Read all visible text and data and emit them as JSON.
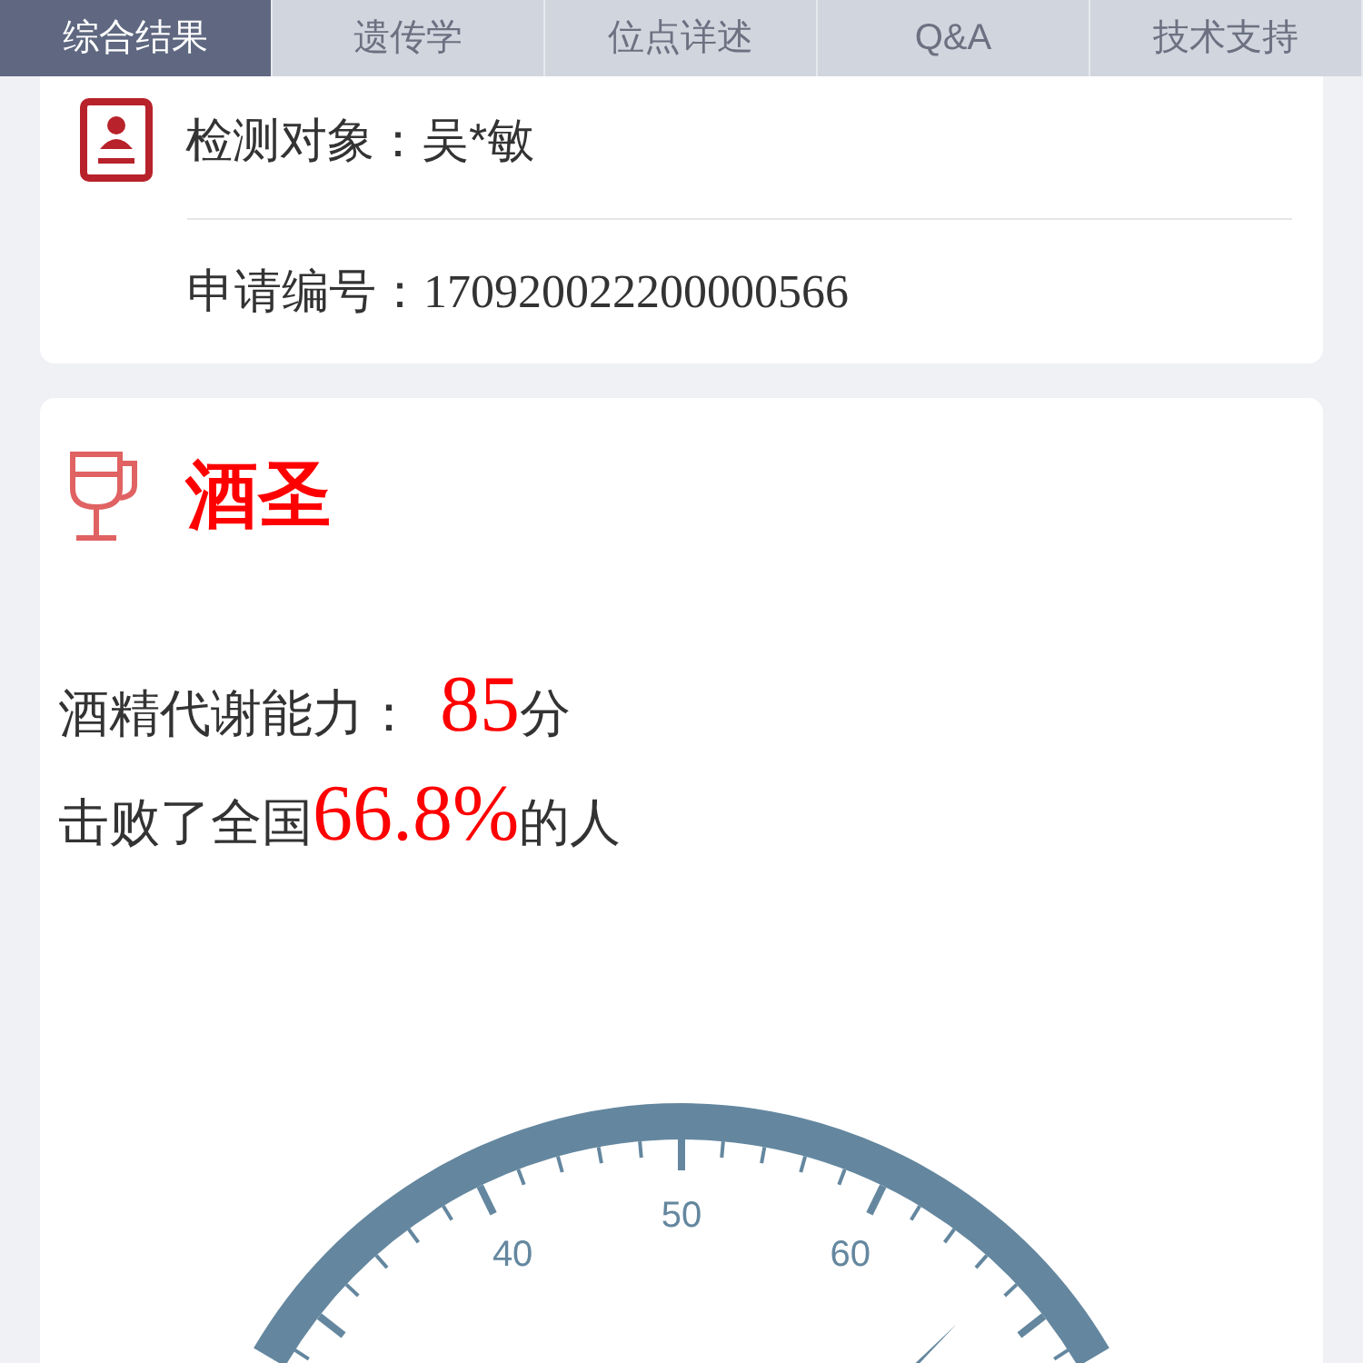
{
  "tabs": [
    {
      "label": "综合结果",
      "selected": true
    },
    {
      "label": "遗传学",
      "selected": false
    },
    {
      "label": "位点详述",
      "selected": false
    },
    {
      "label": "Q&A",
      "selected": false
    },
    {
      "label": "技术支持",
      "selected": false
    }
  ],
  "subject": {
    "label": "检测对象：",
    "value": "吴*敏"
  },
  "application": {
    "label": "申请编号：",
    "value": "170920022200000566"
  },
  "result": {
    "title": "酒圣",
    "score_label": "酒精代谢能力：",
    "score": "85",
    "score_unit": "分",
    "beat_prefix": "击败了全国",
    "beat_value": "66.8%",
    "beat_suffix": "的人"
  },
  "gauge": {
    "tick_labels": [
      "40",
      "50",
      "60"
    ]
  }
}
